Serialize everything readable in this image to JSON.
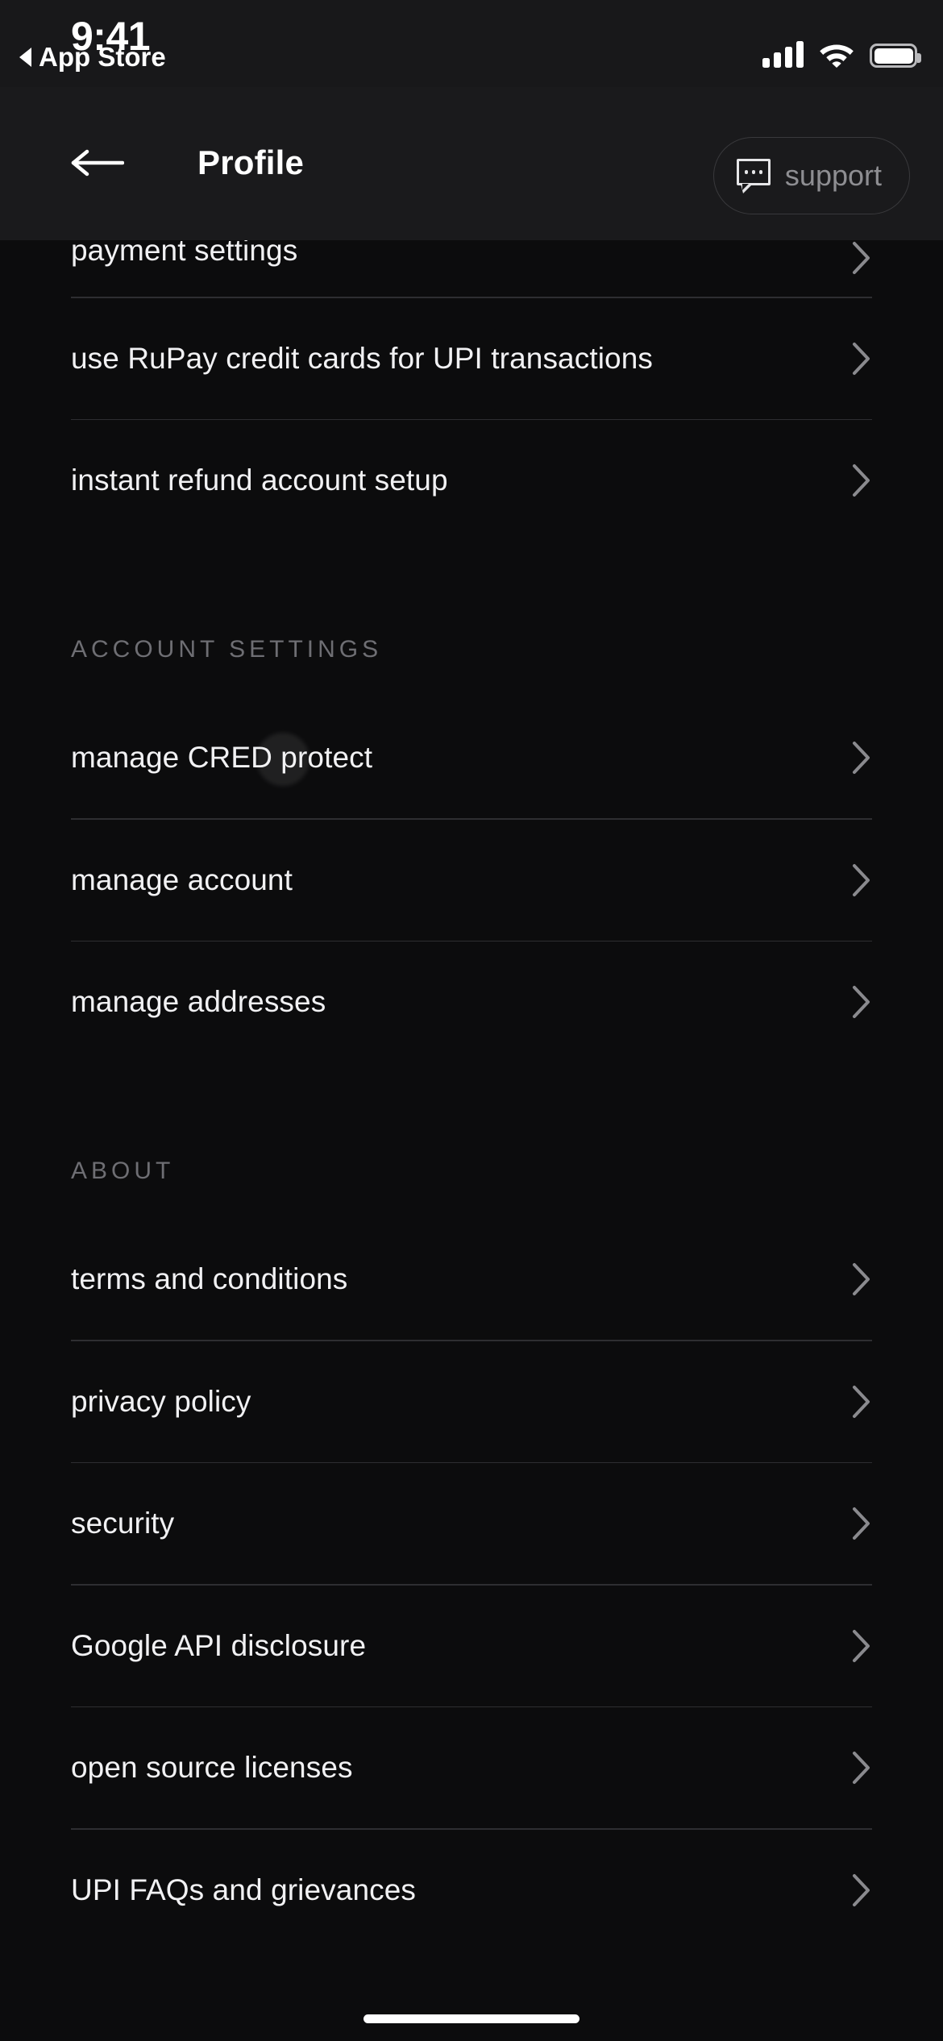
{
  "status_bar": {
    "time": "9:41",
    "back_app": "App Store",
    "signal_icon": "cellular-bars-icon",
    "wifi_icon": "wifi-icon",
    "battery_icon": "battery-full-icon"
  },
  "header": {
    "back_icon": "arrow-left-icon",
    "title": "Profile",
    "support_label": "support",
    "support_icon": "speech-bubble-icon"
  },
  "colors": {
    "page_background": "#0c0c0d",
    "header_background": "#1a1a1c",
    "statusbar_background": "#18181a",
    "label": "#f1f1f3",
    "section_heading": "#6e6e73",
    "divider": "#2e2e31",
    "chevron": "#8a8a8e",
    "support_text": "#8e8e92"
  },
  "sections": [
    {
      "heading": null,
      "items": [
        {
          "label": "payment settings",
          "chevron": "chevron-right-icon",
          "partial": true
        },
        {
          "label": "use RuPay credit cards for UPI transactions",
          "chevron": "chevron-right-icon"
        },
        {
          "label": "instant refund account setup",
          "chevron": "chevron-right-icon"
        }
      ]
    },
    {
      "heading": "ACCOUNT SETTINGS",
      "items": [
        {
          "label": "manage CRED protect",
          "chevron": "chevron-right-icon",
          "ripple": true
        },
        {
          "label": "manage account",
          "chevron": "chevron-right-icon"
        },
        {
          "label": "manage addresses",
          "chevron": "chevron-right-icon"
        }
      ]
    },
    {
      "heading": "ABOUT",
      "items": [
        {
          "label": "terms and conditions",
          "chevron": "chevron-right-icon"
        },
        {
          "label": "privacy policy",
          "chevron": "chevron-right-icon"
        },
        {
          "label": "security",
          "chevron": "chevron-right-icon"
        },
        {
          "label": "Google API disclosure",
          "chevron": "chevron-right-icon"
        },
        {
          "label": "open source licenses",
          "chevron": "chevron-right-icon"
        },
        {
          "label": "UPI FAQs and grievances",
          "chevron": "chevron-right-icon"
        }
      ]
    }
  ],
  "home_indicator": "home-indicator"
}
